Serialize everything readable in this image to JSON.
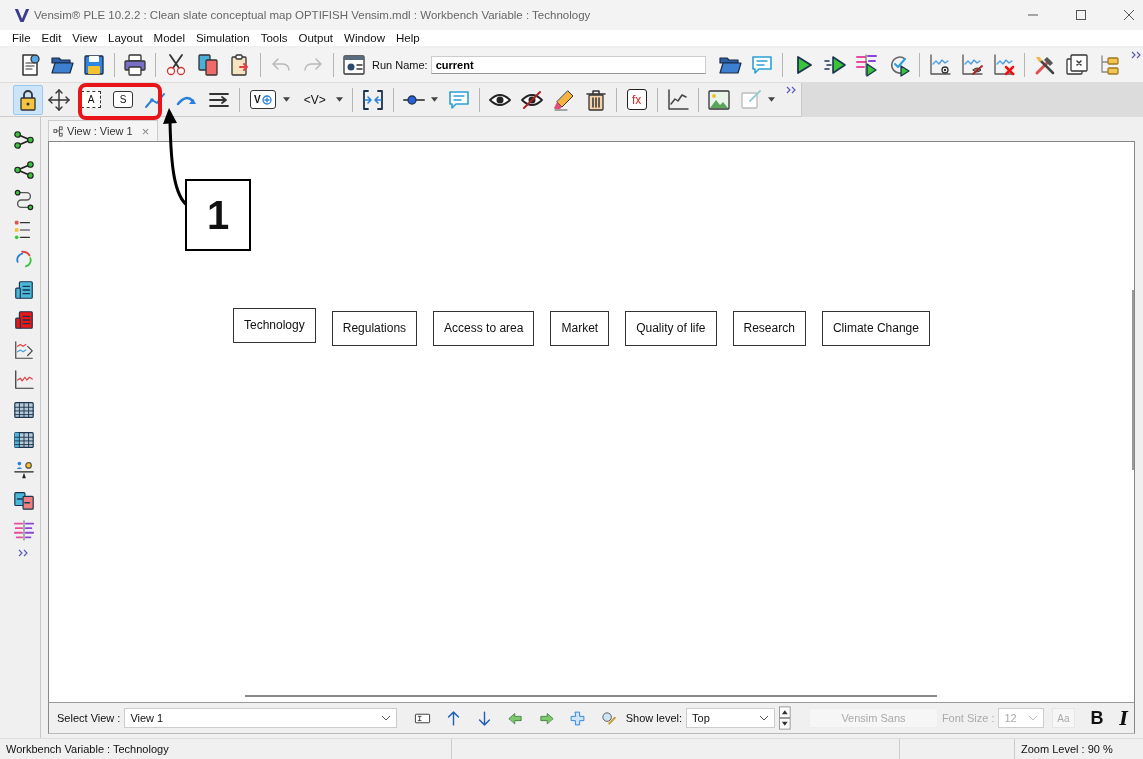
{
  "window": {
    "title": "Vensim® PLE 10.2.2 : Clean slate conceptual map OPTIFISH Vensim.mdl : Workbench Variable : Technology"
  },
  "menu": [
    "File",
    "Edit",
    "View",
    "Layout",
    "Model",
    "Simulation",
    "Tools",
    "Output",
    "Window",
    "Help"
  ],
  "run_name": {
    "label": "Run Name:",
    "value": "current"
  },
  "sketch_tools": {
    "lock_pressed": true,
    "variable": "A",
    "stock": "S",
    "shadow_add": "V",
    "shadow": "<V>",
    "function": "fx"
  },
  "view_tab": {
    "label": "View : View 1",
    "close": "×"
  },
  "variables": [
    {
      "name": "Technology"
    },
    {
      "name": "Regulations"
    },
    {
      "name": "Access to area"
    },
    {
      "name": "Market"
    },
    {
      "name": "Quality of life"
    },
    {
      "name": "Research"
    },
    {
      "name": "Climate Change"
    }
  ],
  "bottom_bar": {
    "select_view_label": "Select View :",
    "view": "View 1",
    "show_level_label": "Show level:",
    "level": "Top",
    "font": "Vensim Sans",
    "font_size_label": "Font Size :",
    "font_size": "12",
    "case_button": "Aa",
    "bold": "B",
    "italic": "I",
    "font_controls_disabled": true
  },
  "status_bar": {
    "message": "Workbench Variable : Technology",
    "zoom": "Zoom Level : 90 %"
  },
  "annotation": {
    "label": "1"
  }
}
